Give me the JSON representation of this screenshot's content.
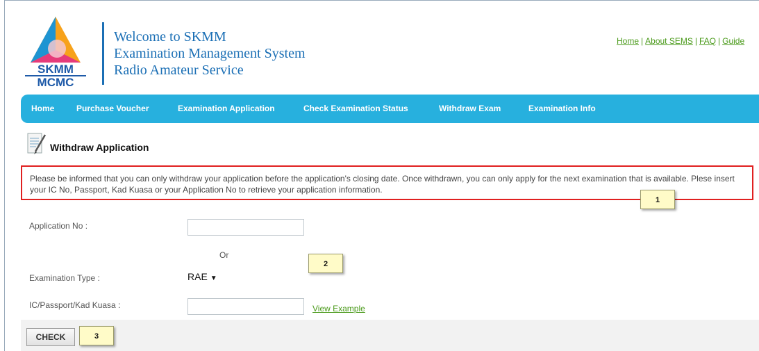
{
  "header": {
    "title_line1": "Welcome to SKMM",
    "title_line2": "Examination Management System",
    "title_line3": "Radio Amateur Service",
    "logo_text_top": "SKMM",
    "logo_text_bottom": "MCMC",
    "top_links": [
      "Home",
      "About SEMS",
      "FAQ",
      "Guide"
    ]
  },
  "nav": {
    "items": [
      "Home",
      "Purchase Voucher",
      "Examination Application",
      "Check Examination Status",
      "Withdraw Exam",
      "Examination Info"
    ]
  },
  "page": {
    "title": "Withdraw Application",
    "notice": "Please be informed that you can only withdraw your application before the application's closing date. Once withdrawn, you can only apply for the next examination that is available. Plese insert your IC No, Passport, Kad Kuasa or your Application No to retrieve your application information."
  },
  "form": {
    "application_no_label": "Application No :",
    "application_no_value": "",
    "or_text": "Or",
    "exam_type_label": "Examination Type :",
    "exam_type_value": "RAE",
    "ic_label": "IC/Passport/Kad Kuasa :",
    "ic_value": "",
    "view_example": "View Example",
    "check_button": "CHECK"
  },
  "callouts": {
    "one": "1",
    "two": "2",
    "three": "3"
  },
  "colors": {
    "nav_bg": "#27b0de",
    "title_blue": "#1b6fb5",
    "link_green": "#4a9a1a",
    "notice_border": "#e02020",
    "callout_bg": "#fffbc8"
  },
  "icons": {
    "logo": "skmm-triangle-logo",
    "page_icon": "document-pencil-icon",
    "select_arrow": "caret-down-icon"
  }
}
